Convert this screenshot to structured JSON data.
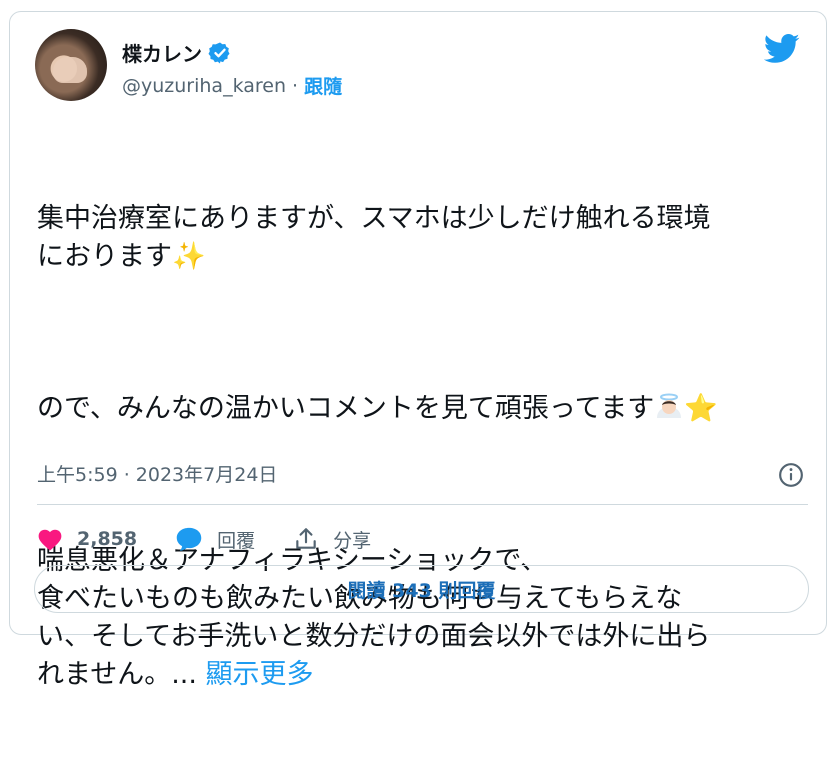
{
  "author": {
    "display_name": "楪カレン",
    "handle": "@yuzuriha_karen",
    "separator": "·",
    "follow_label": "跟隨"
  },
  "tweet": {
    "paragraph1_line1": "集中治療室にありますが、スマホは少しだけ触れる環境",
    "paragraph1_line2": "におります",
    "paragraph1_emoji": "✨",
    "paragraph2": "ので、みんなの温かいコメントを見て頑張ってます",
    "paragraph2_star": "⭐",
    "paragraph3_line1": "喘息悪化＆アナフィラキシーショックで、",
    "paragraph3_line2": "食べたいものも飲みたい飲み物も何も与えてもらえな",
    "paragraph3_line3": "い、そしてお手洗いと数分だけの面会以外では外に出ら",
    "paragraph3_line4": "れません。...",
    "show_more": "顯示更多"
  },
  "timestamp": "上午5:59 · 2023年7月24日",
  "actions": {
    "likes": "2,858",
    "reply_label": "回覆",
    "share_label": "分享"
  },
  "read_replies": "閱讀 343 則回覆",
  "colors": {
    "brand": "#1d9bf0",
    "like": "#f91880",
    "text": "#0f1419",
    "muted": "#536471"
  },
  "icons": [
    "verified-badge-icon",
    "twitter-bird-icon",
    "info-icon",
    "heart-icon",
    "reply-bubble-icon",
    "share-icon"
  ]
}
